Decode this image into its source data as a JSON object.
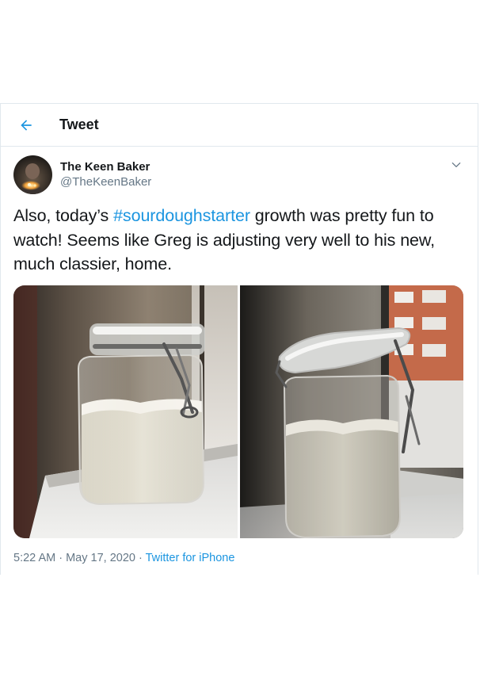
{
  "header": {
    "title": "Tweet"
  },
  "author": {
    "display_name": "The Keen Baker",
    "handle": "@TheKeenBaker"
  },
  "tweet": {
    "text_before": "Also, today’s ",
    "hashtag": "#sourdoughstarter",
    "text_after": " growth was pretty fun to watch! Seems like Greg is adjusting very well to his new, much classier, home."
  },
  "meta": {
    "time": "5:22 AM",
    "separator_1": " · ",
    "date": "May 17, 2020",
    "separator_2": " · ",
    "source": "Twitter for iPhone"
  },
  "icons": {
    "back": "arrow-left-icon",
    "more": "chevron-down-icon"
  },
  "colors": {
    "accent": "#1b95e0",
    "text": "#14171a",
    "secondary_text": "#657786",
    "border": "#e1e8ed"
  }
}
